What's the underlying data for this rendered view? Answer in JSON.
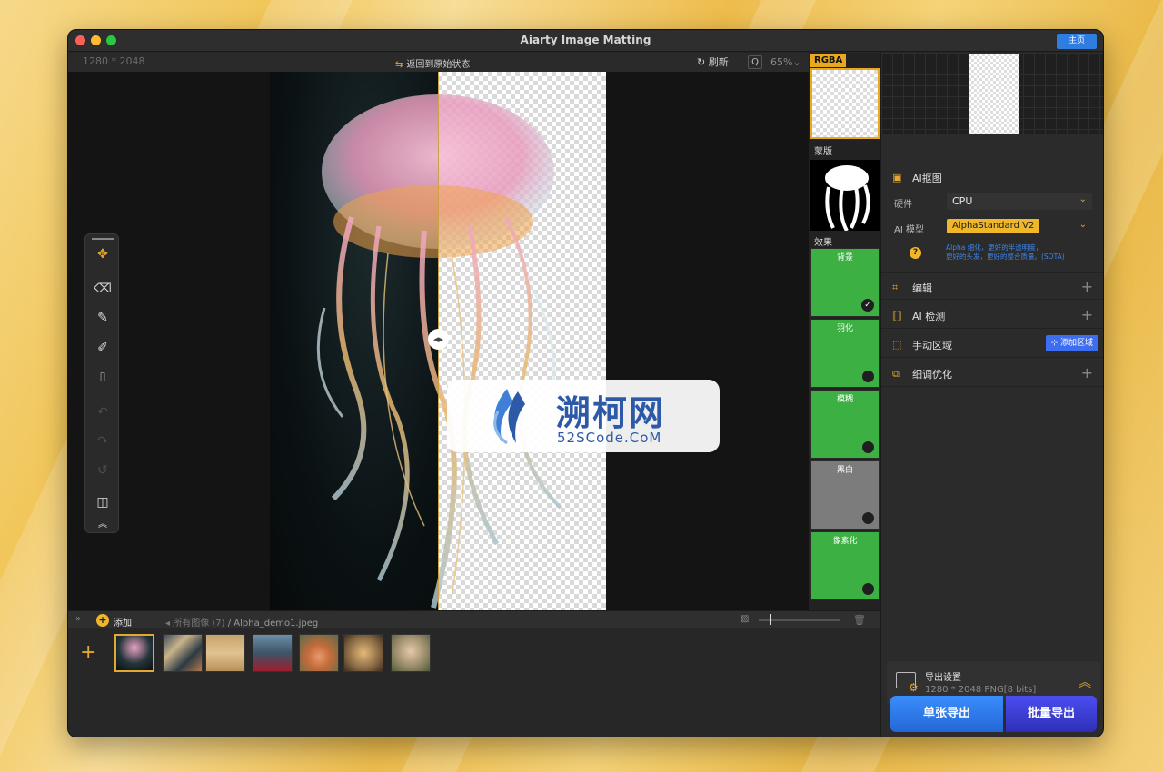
{
  "window": {
    "title": "Aiarty Image Matting",
    "home_label": "主页"
  },
  "toolbar": {
    "dimensions": "1280 * 2048",
    "revert_label": "返回到原始状态",
    "refresh_label": "刷新",
    "zoom": "65%"
  },
  "watermark": {
    "title": "溯柯网",
    "subtitle": "52SCode.CoM"
  },
  "effects_panel": {
    "rgba_label": "RGBA",
    "mask_label": "蒙版",
    "effects_label": "效果",
    "effects": [
      {
        "label": "背景",
        "checked": true
      },
      {
        "label": "羽化",
        "checked": false
      },
      {
        "label": "模糊",
        "checked": false
      },
      {
        "label": "黑白",
        "checked": false
      },
      {
        "label": "像素化",
        "checked": false
      }
    ]
  },
  "right_panel": {
    "ai_matting_label": "AI抠图",
    "hardware_label": "硬件",
    "hardware_value": "CPU",
    "model_label": "AI 模型",
    "model_value": "AlphaStandard  V2",
    "help_line1": "Alpha 细化，更好的半透明度，",
    "help_line2": "更好的头发，更好的整合质量。(SOTA)",
    "edit_label": "编辑",
    "detect_label": "AI 检测",
    "manual_label": "手动区域",
    "add_area_label": "添加区域",
    "refine_label": "细调优化",
    "export_title": "导出设置",
    "export_sub": "1280 * 2048 PNG[8 bits]",
    "single_export_label": "单张导出",
    "batch_export_label": "批量导出"
  },
  "filebar": {
    "add_label": "添加",
    "all_images": "所有图像 (7)",
    "current_file": "/ Alpha_demo1.jpeg"
  },
  "thumbnails": [
    {
      "name": "jellyfish",
      "active": true
    },
    {
      "name": "feathers",
      "active": false
    },
    {
      "name": "bicycle",
      "active": false
    },
    {
      "name": "red-dress",
      "active": false
    },
    {
      "name": "flowers",
      "active": false
    },
    {
      "name": "golden-woman",
      "active": false
    },
    {
      "name": "floral-woman",
      "active": false
    }
  ],
  "colors": {
    "accent": "#e2a831",
    "primary_blue": "#2f7de0",
    "effect_green": "#3cb043"
  }
}
